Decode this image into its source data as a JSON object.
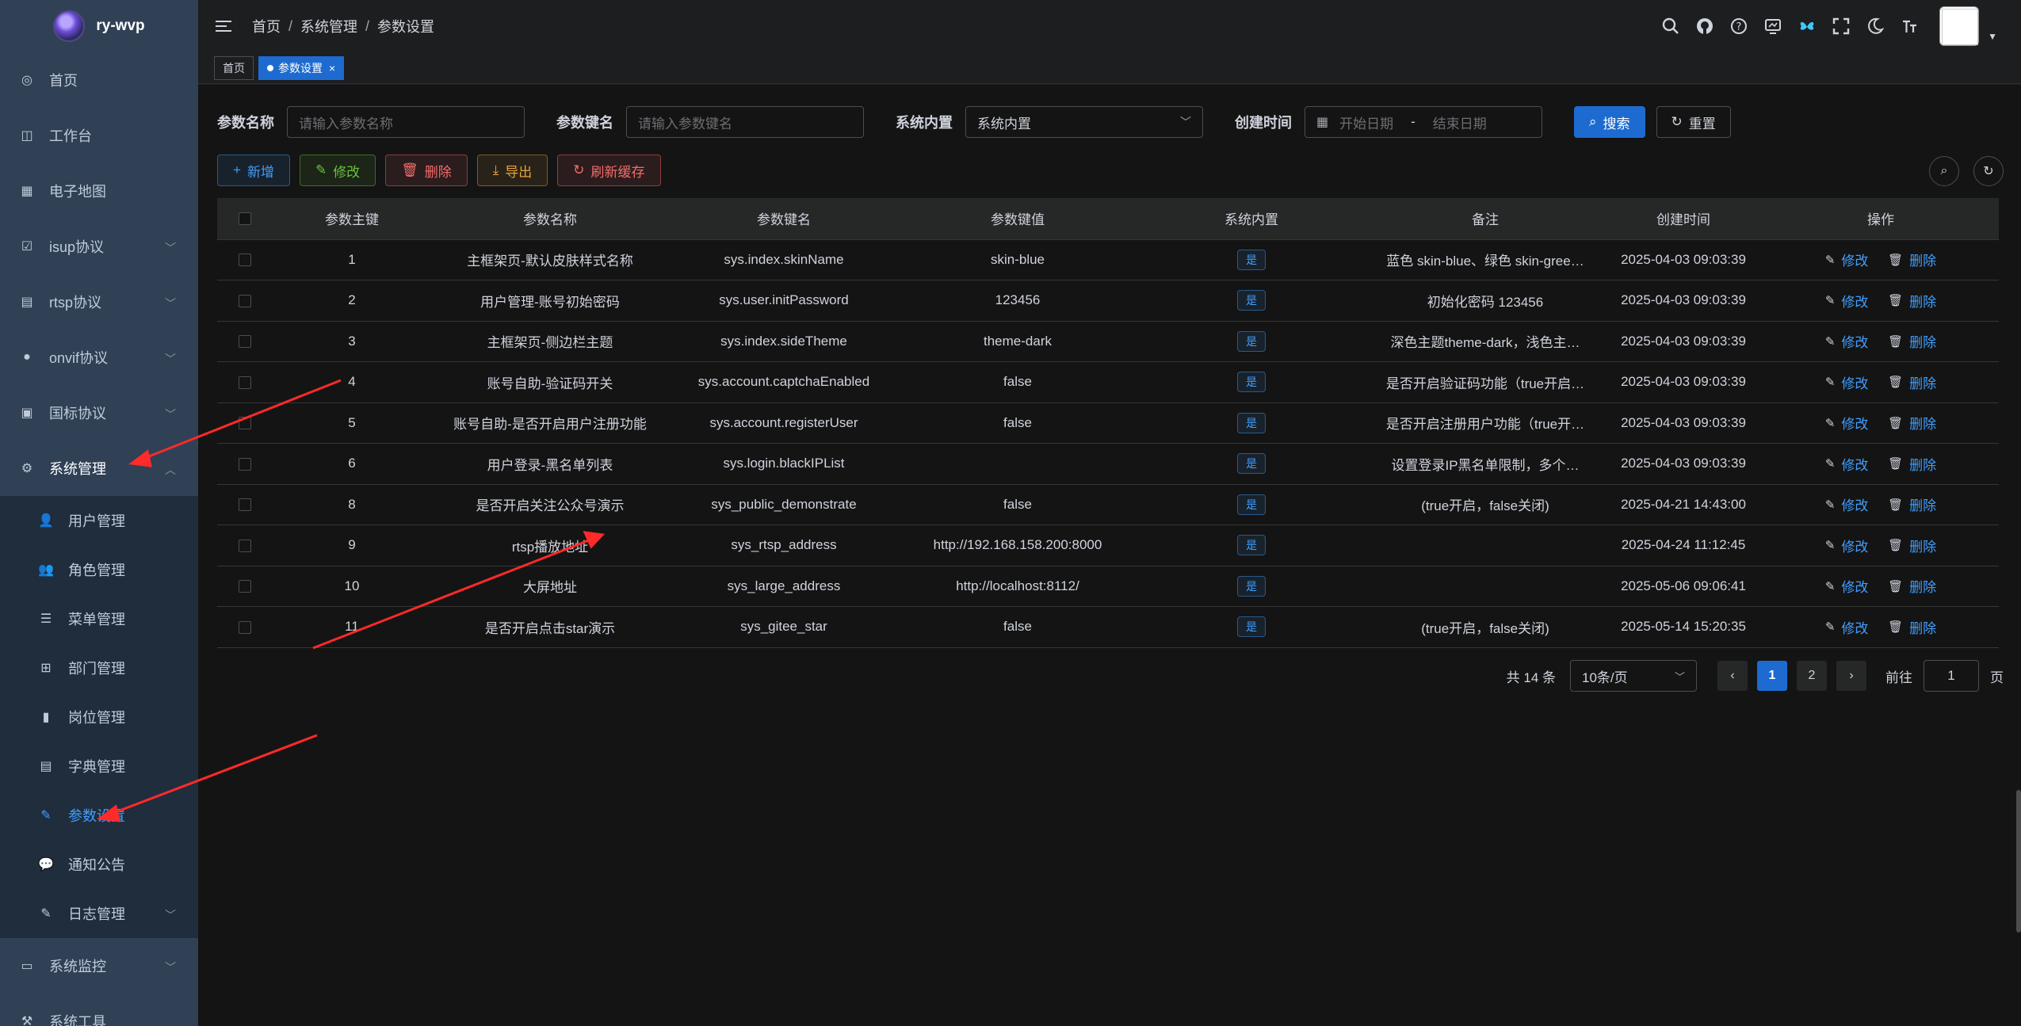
{
  "app": {
    "title": "ry-wvp"
  },
  "sidebar": {
    "items": [
      {
        "label": "首页",
        "icon": "dashboard-icon"
      },
      {
        "label": "工作台",
        "icon": "workbench-icon"
      },
      {
        "label": "电子地图",
        "icon": "map-icon"
      },
      {
        "label": "isup协议",
        "icon": "isup-icon"
      },
      {
        "label": "rtsp协议",
        "icon": "rtsp-icon"
      },
      {
        "label": "onvif协议",
        "icon": "onvif-icon"
      },
      {
        "label": "国标协议",
        "icon": "gb-icon"
      },
      {
        "label": "系统管理",
        "icon": "gear-icon"
      }
    ],
    "system_sub": [
      {
        "label": "用户管理",
        "icon": "user-icon"
      },
      {
        "label": "角色管理",
        "icon": "role-icon"
      },
      {
        "label": "菜单管理",
        "icon": "menu-list-icon"
      },
      {
        "label": "部门管理",
        "icon": "tree-icon"
      },
      {
        "label": "岗位管理",
        "icon": "post-icon"
      },
      {
        "label": "字典管理",
        "icon": "dict-icon"
      },
      {
        "label": "参数设置",
        "icon": "edit-icon"
      },
      {
        "label": "通知公告",
        "icon": "message-icon"
      },
      {
        "label": "日志管理",
        "icon": "log-icon"
      }
    ],
    "after": [
      {
        "label": "系统监控",
        "icon": "monitor-icon"
      },
      {
        "label": "系统工具",
        "icon": "tool-icon"
      }
    ]
  },
  "breadcrumb": [
    "首页",
    "系统管理",
    "参数设置"
  ],
  "tags": [
    {
      "label": "首页"
    },
    {
      "label": "参数设置"
    }
  ],
  "search": {
    "name_label": "参数名称",
    "name_placeholder": "请输入参数名称",
    "key_label": "参数键名",
    "key_placeholder": "请输入参数键名",
    "type_label": "系统内置",
    "type_value": "系统内置",
    "time_label": "创建时间",
    "start_placeholder": "开始日期",
    "range_sep": "-",
    "end_placeholder": "结束日期",
    "search_btn": "搜索",
    "reset_btn": "重置"
  },
  "toolbar": {
    "add": "新增",
    "edit": "修改",
    "delete": "删除",
    "export": "导出",
    "refresh_cache": "刷新缓存"
  },
  "table": {
    "headers": [
      "参数主键",
      "参数名称",
      "参数键名",
      "参数键值",
      "系统内置",
      "备注",
      "创建时间",
      "操作"
    ],
    "rows": [
      {
        "id": "1",
        "name": "主框架页-默认皮肤样式名称",
        "key": "sys.index.skinName",
        "value": "skin-blue",
        "builtin": "是",
        "remark": "蓝色 skin-blue、绿色 skin-gree…",
        "time": "2025-04-03 09:03:39"
      },
      {
        "id": "2",
        "name": "用户管理-账号初始密码",
        "key": "sys.user.initPassword",
        "value": "123456",
        "builtin": "是",
        "remark": "初始化密码 123456",
        "time": "2025-04-03 09:03:39"
      },
      {
        "id": "3",
        "name": "主框架页-侧边栏主题",
        "key": "sys.index.sideTheme",
        "value": "theme-dark",
        "builtin": "是",
        "remark": "深色主题theme-dark，浅色主…",
        "time": "2025-04-03 09:03:39"
      },
      {
        "id": "4",
        "name": "账号自助-验证码开关",
        "key": "sys.account.captchaEnabled",
        "value": "false",
        "builtin": "是",
        "remark": "是否开启验证码功能（true开启…",
        "time": "2025-04-03 09:03:39"
      },
      {
        "id": "5",
        "name": "账号自助-是否开启用户注册功能",
        "key": "sys.account.registerUser",
        "value": "false",
        "builtin": "是",
        "remark": "是否开启注册用户功能（true开…",
        "time": "2025-04-03 09:03:39"
      },
      {
        "id": "6",
        "name": "用户登录-黑名单列表",
        "key": "sys.login.blackIPList",
        "value": "",
        "builtin": "是",
        "remark": "设置登录IP黑名单限制，多个…",
        "time": "2025-04-03 09:03:39"
      },
      {
        "id": "8",
        "name": "是否开启关注公众号演示",
        "key": "sys_public_demonstrate",
        "value": "false",
        "builtin": "是",
        "remark": "(true开启，false关闭)",
        "time": "2025-04-21 14:43:00"
      },
      {
        "id": "9",
        "name": "rtsp播放地址",
        "key": "sys_rtsp_address",
        "value": "http://192.168.158.200:8000",
        "builtin": "是",
        "remark": "",
        "time": "2025-04-24 11:12:45"
      },
      {
        "id": "10",
        "name": "大屏地址",
        "key": "sys_large_address",
        "value": "http://localhost:8112/",
        "builtin": "是",
        "remark": "",
        "time": "2025-05-06 09:06:41"
      },
      {
        "id": "11",
        "name": "是否开启点击star演示",
        "key": "sys_gitee_star",
        "value": "false",
        "builtin": "是",
        "remark": "(true开启，false关闭)",
        "time": "2025-05-14 15:20:35"
      }
    ],
    "op_edit": "修改",
    "op_delete": "删除"
  },
  "pagination": {
    "total": "共 14 条",
    "page_size": "10条/页",
    "pages": [
      "1",
      "2"
    ],
    "current": "1",
    "goto_label": "前往",
    "goto_value": "1",
    "goto_unit": "页"
  },
  "colors": {
    "sidebar_bg": "#304156",
    "primary": "#1d6bd1",
    "link": "#409eff",
    "annotation": "#ff2a2a"
  }
}
